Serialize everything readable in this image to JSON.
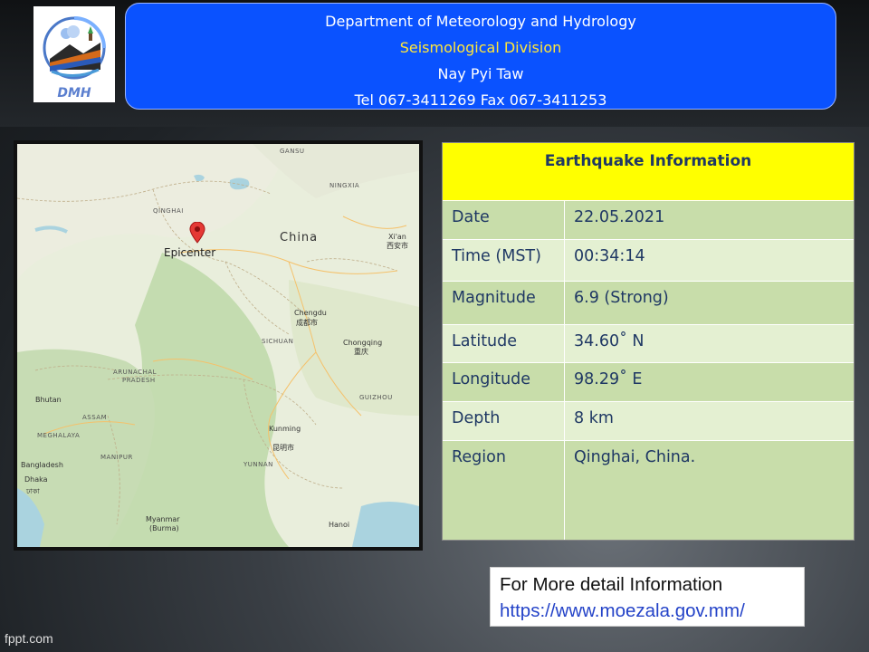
{
  "logo": {
    "text": "DMH"
  },
  "header": {
    "line1": "Department of Meteorology and Hydrology",
    "line2": "Seismological Division",
    "line3": "Nay Pyi Taw",
    "line4": "Tel 067-3411269 Fax 067-3411253"
  },
  "map": {
    "epicenter_label": "Epicenter",
    "country_label": "China",
    "places": [
      "GANSU",
      "QINGHAI",
      "NINGXIA",
      "Xi'an",
      "西安市",
      "Chengdu",
      "成都市",
      "SICHUAN",
      "Chongqing",
      "重庆",
      "GUIZHOU",
      "Kunming",
      "昆明市",
      "YUNNAN",
      "Hanoi",
      "Myanmar",
      "(Burma)",
      "Bangladesh",
      "Dhaka",
      "ঢাকা",
      "Bhutan",
      "ASSAM",
      "MEGHALAYA",
      "MANIPUR",
      "ARUNACHAL",
      "PRADESH"
    ]
  },
  "info": {
    "title": "Earthquake Information",
    "rows": [
      {
        "label": "Date",
        "value": "22.05.2021"
      },
      {
        "label": "Time (MST)",
        "value": "00:34:14"
      },
      {
        "label": "Magnitude",
        "value": "6.9 (Strong)"
      },
      {
        "label": "Latitude",
        "value": "34.60˚ N"
      },
      {
        "label": "Longitude",
        "value": "98.29˚ E"
      },
      {
        "label": "Depth",
        "value": "8 km"
      },
      {
        "label": "Region",
        "value": "Qinghai, China."
      }
    ]
  },
  "more": {
    "line1": "For More detail Information",
    "line2": "https://www.moezala.gov.mm/"
  },
  "footer": {
    "brand": "fppt.com"
  },
  "colors": {
    "header_bg": "#0a52ff",
    "title_bg": "#ffff00",
    "table_text": "#1f3864",
    "link": "#2443c8"
  }
}
